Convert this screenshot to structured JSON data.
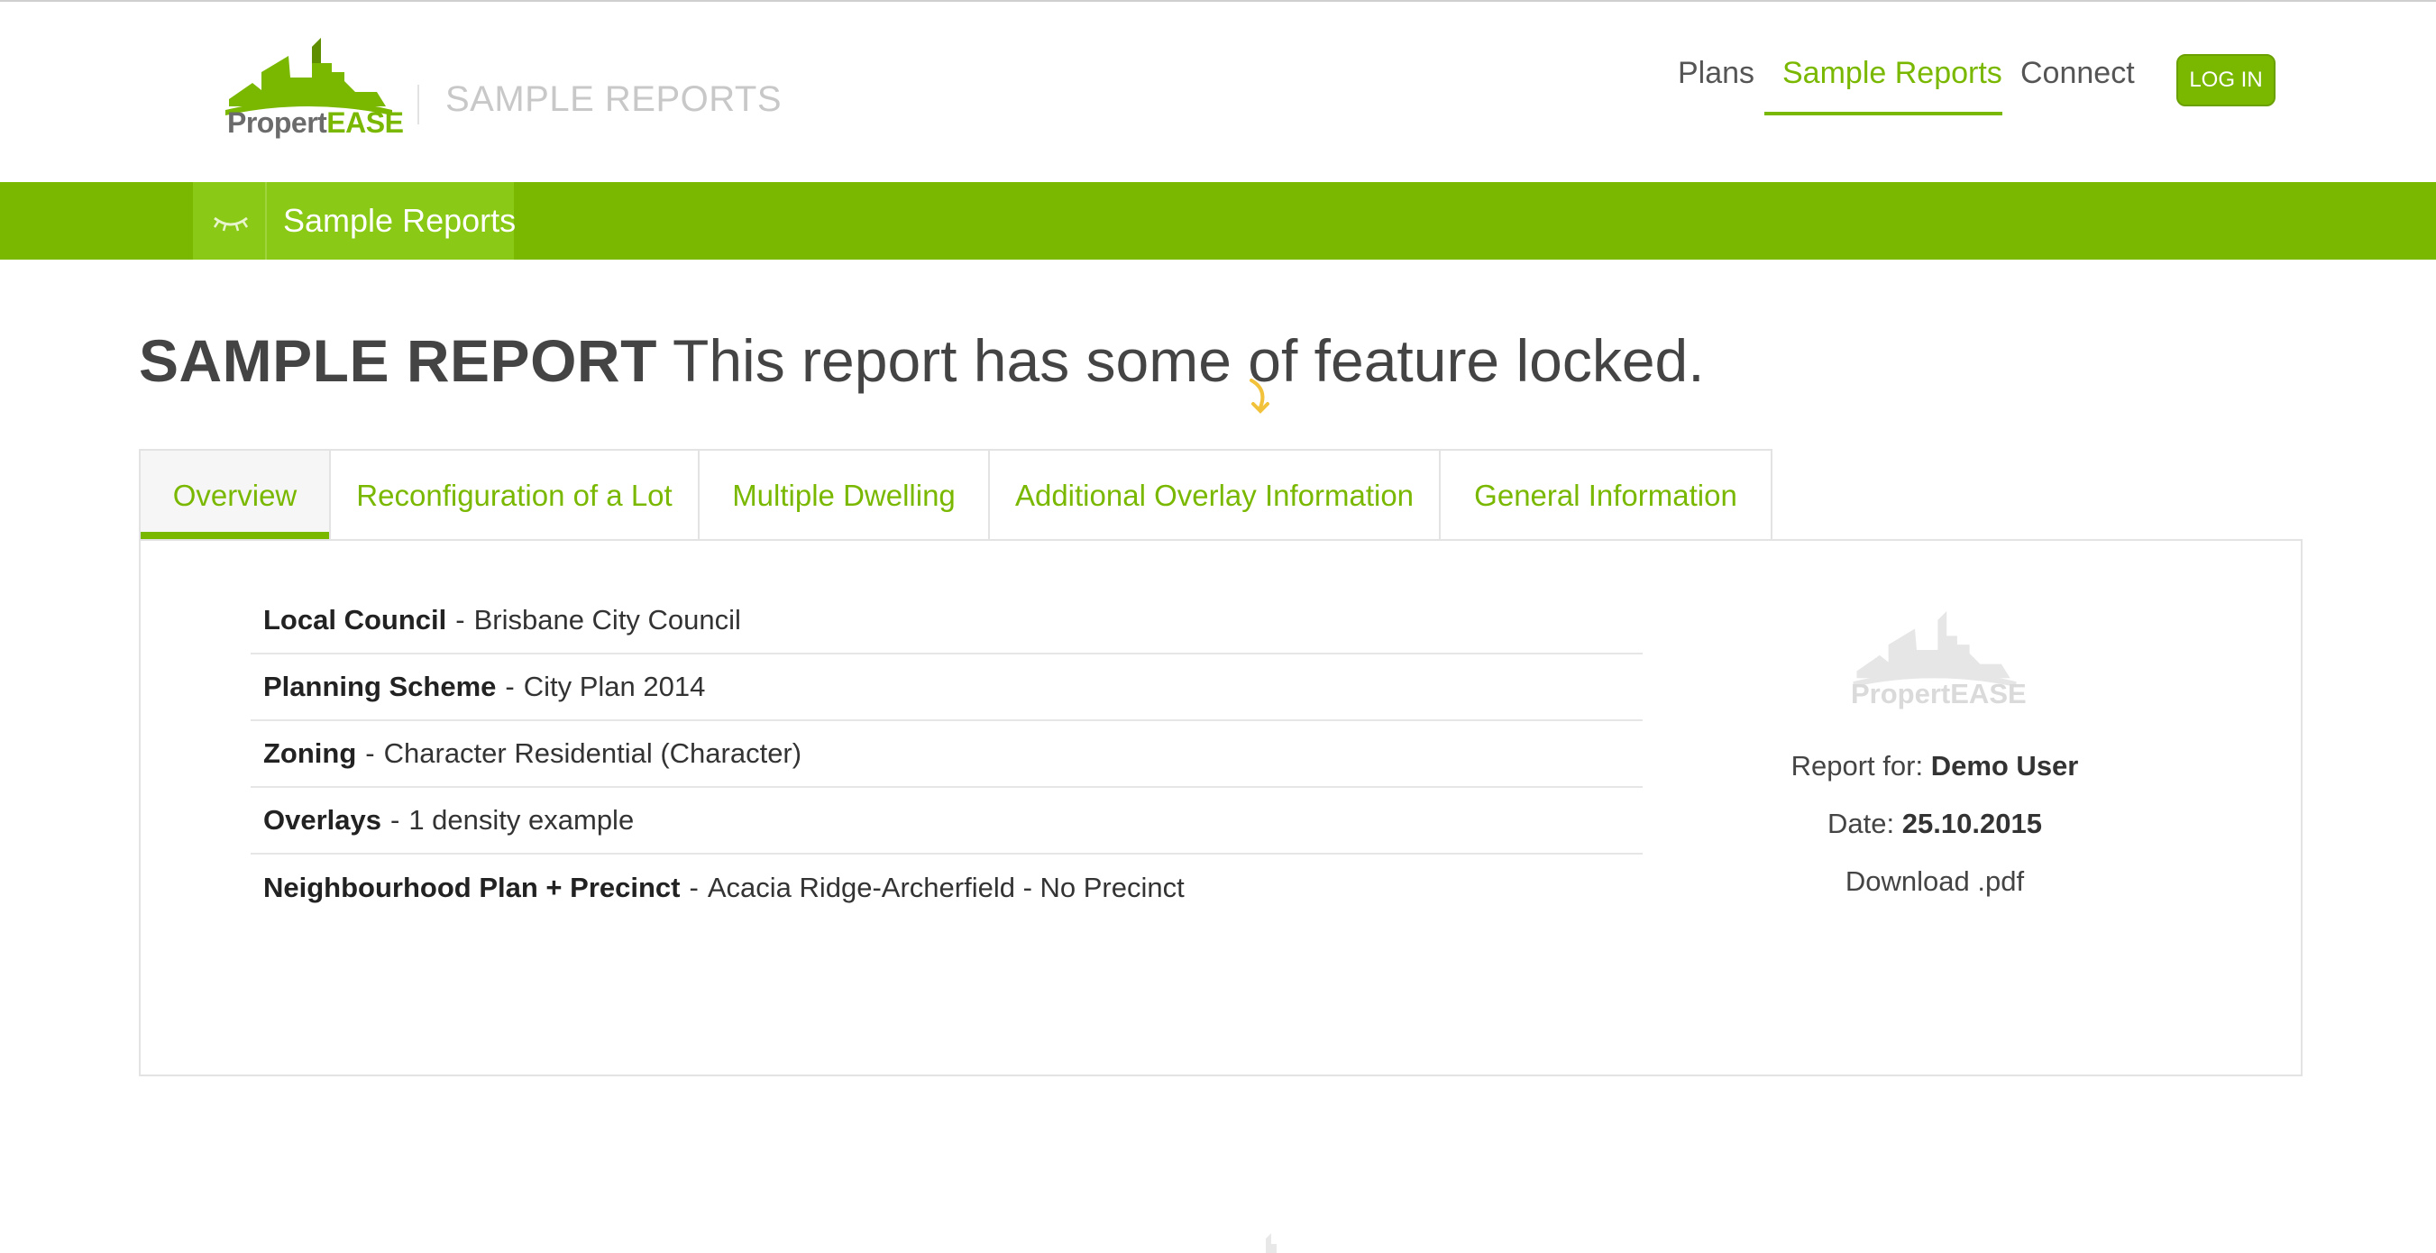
{
  "header": {
    "logo": {
      "text_prefix": "Propert",
      "text_suffix": "EASE"
    },
    "section_title": "SAMPLE REPORTS",
    "nav": {
      "plans": "Plans",
      "sample_reports": "Sample Reports",
      "connect": "Connect",
      "login": "LOG IN"
    },
    "active_nav": "Sample Reports"
  },
  "breadcrumb": {
    "icon": "eye-closed-icon",
    "label": "Sample Reports"
  },
  "page": {
    "heading_bold": "SAMPLE REPORT",
    "heading_rest": " This report has some of feature locked."
  },
  "tabs": [
    {
      "label": "Overview",
      "active": true
    },
    {
      "label": "Reconfiguration of a Lot",
      "active": false
    },
    {
      "label": "Multiple Dwelling",
      "active": false
    },
    {
      "label": "Additional Overlay Information",
      "active": false
    },
    {
      "label": "General Information",
      "active": false
    }
  ],
  "overview": {
    "rows": [
      {
        "label": "Local Council",
        "value": "Brisbane City Council"
      },
      {
        "label": "Planning Scheme",
        "value": "City Plan 2014"
      },
      {
        "label": "Zoning",
        "value": "Character Residential (Character)"
      },
      {
        "label": "Overlays",
        "value": "1 density example"
      },
      {
        "label": "Neighbourhood Plan + Precinct",
        "value": "Acacia Ridge-Archerfield - No Precinct"
      }
    ],
    "separator": "-",
    "report_for_label": "Report for:",
    "report_for_value": "Demo User",
    "date_label": "Date:",
    "date_value": "25.10.2015",
    "download_label": "Download .pdf"
  },
  "colors": {
    "brand_green": "#7ab800",
    "breadcrumb_green": "#8ac915",
    "text_dark": "#333333",
    "muted": "#c8c8c8"
  }
}
